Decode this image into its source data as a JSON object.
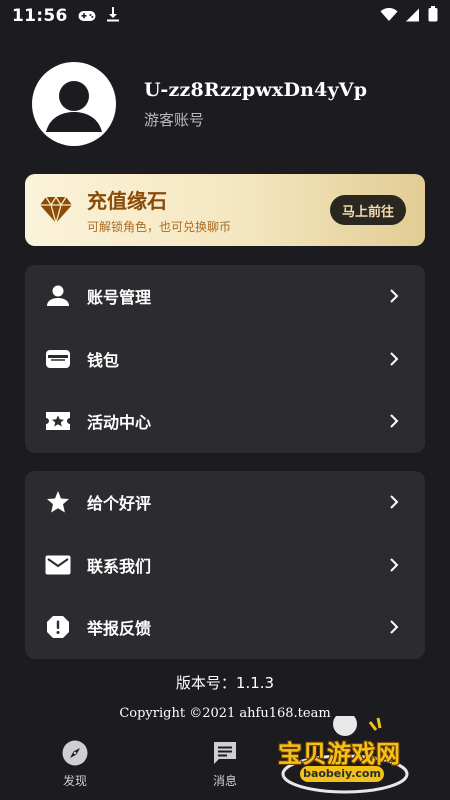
{
  "status_bar": {
    "time": "11:56"
  },
  "profile": {
    "username": "U-zz8RzzpwxDn4yVp",
    "account_type": "游客账号"
  },
  "recharge": {
    "title": "充值缘石",
    "subtitle": "可解锁角色，也可兑换聊币",
    "button": "马上前往",
    "accent": "#8a4b08"
  },
  "menu_primary": [
    {
      "label": "账号管理",
      "icon": "person-icon"
    },
    {
      "label": "钱包",
      "icon": "wallet-icon"
    },
    {
      "label": "活动中心",
      "icon": "ticket-star-icon"
    }
  ],
  "menu_secondary": [
    {
      "label": "给个好评",
      "icon": "star-icon"
    },
    {
      "label": "联系我们",
      "icon": "mail-icon"
    },
    {
      "label": "举报反馈",
      "icon": "report-icon"
    }
  ],
  "footer": {
    "version": "版本号：1.1.3",
    "copyright": "Copyright ©2021 ahfu168.team"
  },
  "bottom_nav": [
    {
      "label": "发现",
      "icon": "compass-icon"
    },
    {
      "label": "消息",
      "icon": "chat-icon"
    }
  ],
  "watermark": {
    "text": "宝贝游戏网",
    "url": "baobeiy.com"
  }
}
